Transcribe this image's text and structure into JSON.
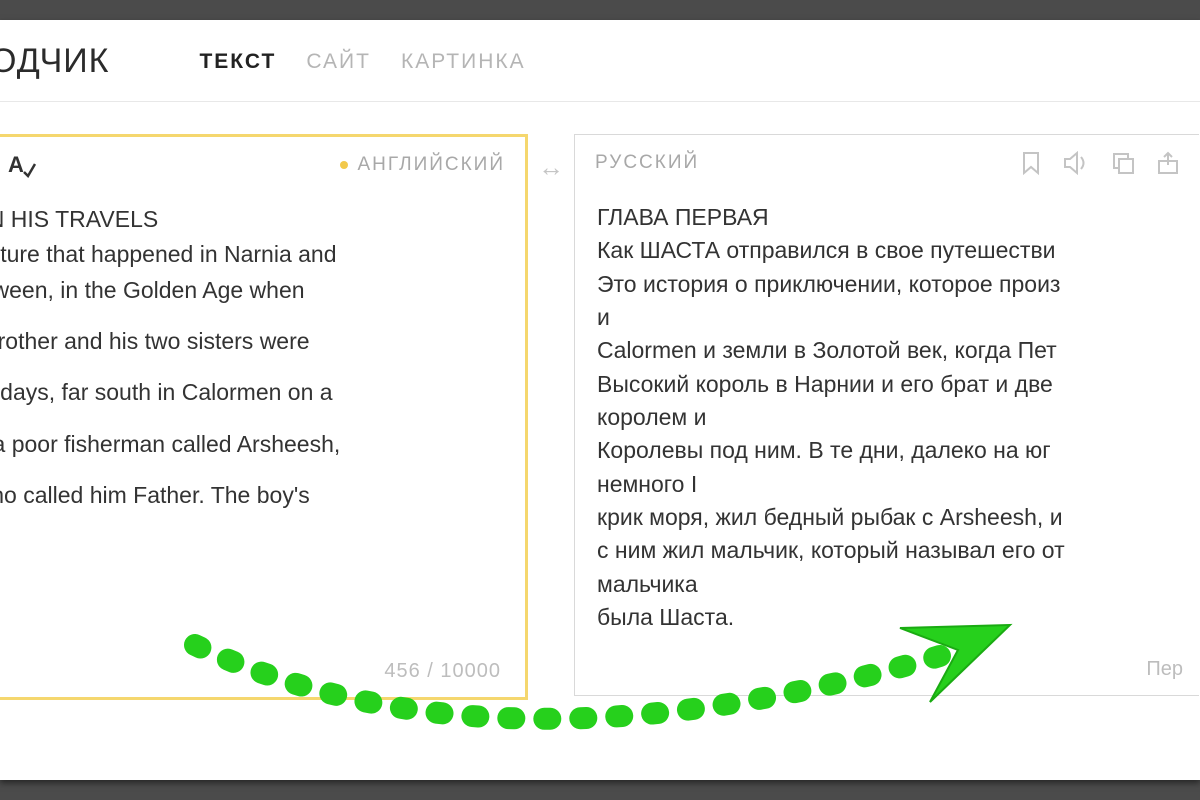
{
  "header": {
    "logo": "ОДЧИК",
    "tabs": [
      {
        "label": "ТЕКСТ",
        "active": true
      },
      {
        "label": "САЙТ",
        "active": false
      },
      {
        "label": "КАРТИНКА",
        "active": false
      }
    ]
  },
  "source": {
    "lang": "АНГЛИЙСКИЙ",
    "lines_tight": [
      "ET OUT ON HIS TRAVELS",
      "of an adventure that happened in Narnia and",
      "e lands between, in the Golden Age when"
    ],
    "lines_loose": [
      "ia and his brother and his two sisters were",
      "m. In those days, far south in Calormen on a",
      "there lived a poor fisherman called Arsheesh,",
      "ed a boy who called him Father. The boy's"
    ],
    "counter": "456 / 10000"
  },
  "target": {
    "lang": "РУССКИЙ",
    "text": "ГЛАВА ПЕРВАЯ\nКак ШАСТА отправился в свое путешестви\nЭто история о приключении, которое произ\nи\nCalormen и земли в Золотой век, когда Пет\nВысокий король в Нарнии и его брат и две\nкоролем и\nКоролевы под ним. В те дни, далеко на юг\nнемного I\nкрик моря, жил бедный рыбак с Arsheesh, и\nс ним жил мальчик, который называл его от\nмальчика\nбыла Шаста.",
    "footer_link": "Пер"
  },
  "icons": {
    "keyboard": "keyboard-icon",
    "spellcheck": "spellcheck-icon",
    "swap": "↔",
    "bookmark": "bookmark-icon",
    "sound": "sound-icon",
    "copy": "copy-icon",
    "share": "share-icon"
  }
}
